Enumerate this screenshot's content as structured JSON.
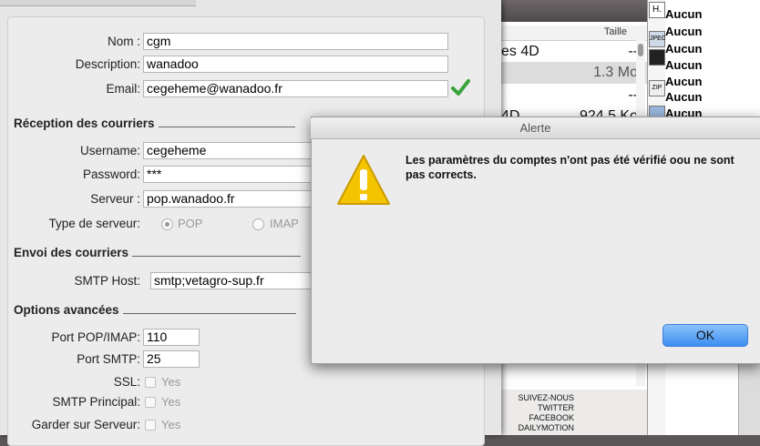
{
  "main_form": {
    "nom_label": "Nom :",
    "nom_value": "cgm",
    "description_label": "Description:",
    "description_value": "wanadoo",
    "email_label": "Email:",
    "email_value": "cegeheme@wanadoo.fr",
    "reception_section": "Réception des courriers",
    "username_label": "Username:",
    "username_value": "cegeheme",
    "password_label": "Password:",
    "password_value": "***",
    "serveur_label": "Serveur :",
    "serveur_value": "pop.wanadoo.fr",
    "type_serveur_label": "Type de serveur:",
    "radio_pop_label": "POP",
    "radio_imap_label": "IMAP",
    "selected_server_type": "POP",
    "envoi_section": "Envoi des courriers",
    "smtp_host_label": "SMTP Host:",
    "smtp_host_value": "smtp;vetagro-sup.fr",
    "options_section": "Options avancées",
    "port_pop_label": "Port POP/IMAP:",
    "port_pop_value": "110",
    "port_smtp_label": "Port SMTP:",
    "port_smtp_value": "25",
    "ssl_label": "SSL:",
    "ssl_option": "Yes",
    "smtp_principal_label": "SMTP Principal:",
    "smtp_principal_option": "Yes",
    "garder_label": "Garder sur Serveur:",
    "garder_option": "Yes"
  },
  "background_app": {
    "column_header": "Taille",
    "rows": [
      {
        "left": "es 4D",
        "right": "--"
      },
      {
        "left": "",
        "right": "1.3 Mo"
      },
      {
        "left": "",
        "right": "--"
      },
      {
        "left": "4D",
        "right": "924.5 Ko"
      }
    ],
    "thumb_labels": [
      "H.",
      "JPEG",
      "",
      "ZIP"
    ],
    "aucun_label": "Aucun",
    "social_links": [
      "SUIVEZ-NOUS",
      "TWITTER",
      "FACEBOOK",
      "DAILYMOTION"
    ]
  },
  "alert": {
    "title": "Alerte",
    "message": "Les paramètres du comptes n'ont pas été vérifié oou ne sont pas corrects.",
    "ok_label": "OK"
  },
  "colors": {
    "ok_button": "#3b8ef0",
    "warning_icon": "#f5c400",
    "check_green": "#3aa43a"
  }
}
